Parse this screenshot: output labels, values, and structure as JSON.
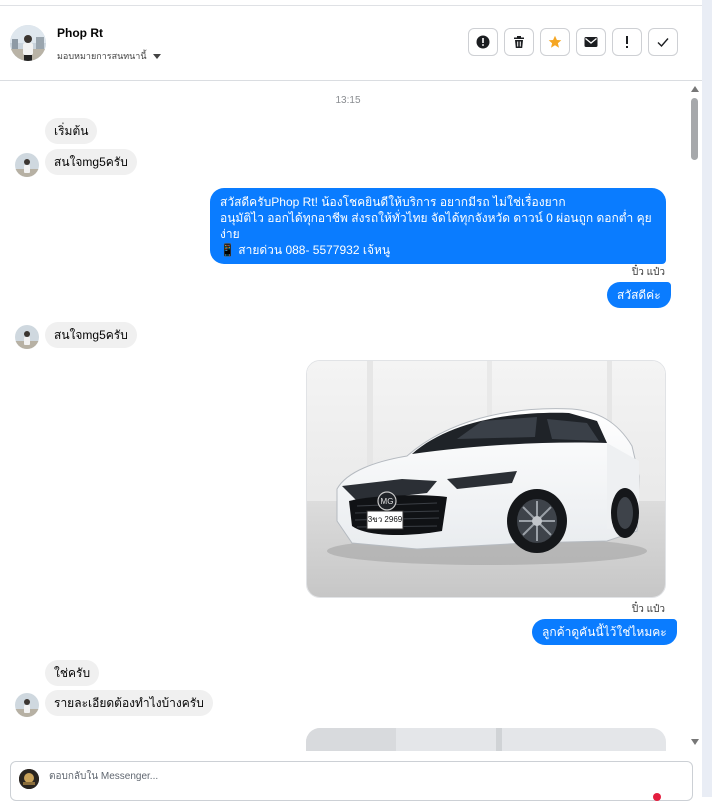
{
  "header": {
    "name": "Phop Rt",
    "assign_label": "มอบหมายการสนทนานี้"
  },
  "toolbar": {
    "buttons": [
      {
        "icon": "alert-circle-icon"
      },
      {
        "icon": "trash-icon"
      },
      {
        "icon": "star-icon",
        "color": "#f5a623"
      },
      {
        "icon": "envelope-icon"
      },
      {
        "icon": "exclamation-icon"
      },
      {
        "icon": "checkmark-icon"
      }
    ]
  },
  "chat": {
    "timestamp": "13:15",
    "messages": {
      "m1": "เริ่มต้น",
      "m2": "สนใจmg5ครับ",
      "m3_line1": "สวัสดีครับPhop Rt! น้องโชคยินดีให้บริการ อยากมีรถ ไม่ใช่เรื่องยาก",
      "m3_line2": "อนุมัติไว ออกได้ทุกอาชีพ ส่งรถให้ทั่วไทย จัดได้ทุกจังหวัด ดาวน์ 0  ผ่อนถูก ดอกต่ำ คุย",
      "m3_line3": "ง่าย",
      "m3_line4": "📱 สายด่วน 088- 5577932 เจ้หนู",
      "seen1": "ปิ๋ว แป๋ว",
      "m4": "สวัสดีค่ะ",
      "m5": "สนใจmg5ครับ",
      "plate": "3ขว 2969",
      "seen2": "ปิ๋ว แป๋ว",
      "m6": "ลูกค้าดูคันนี้ไว้ใช่ไหมคะ",
      "m7": "ใช่ครับ",
      "m8": "รายละเอียดต้องทำไงบ้างครับ"
    }
  },
  "composer": {
    "placeholder": "ตอบกลับใน Messenger..."
  },
  "colors": {
    "outgoing": "#0a7cff",
    "incoming": "#f0f0f0",
    "star": "#f5a623"
  }
}
